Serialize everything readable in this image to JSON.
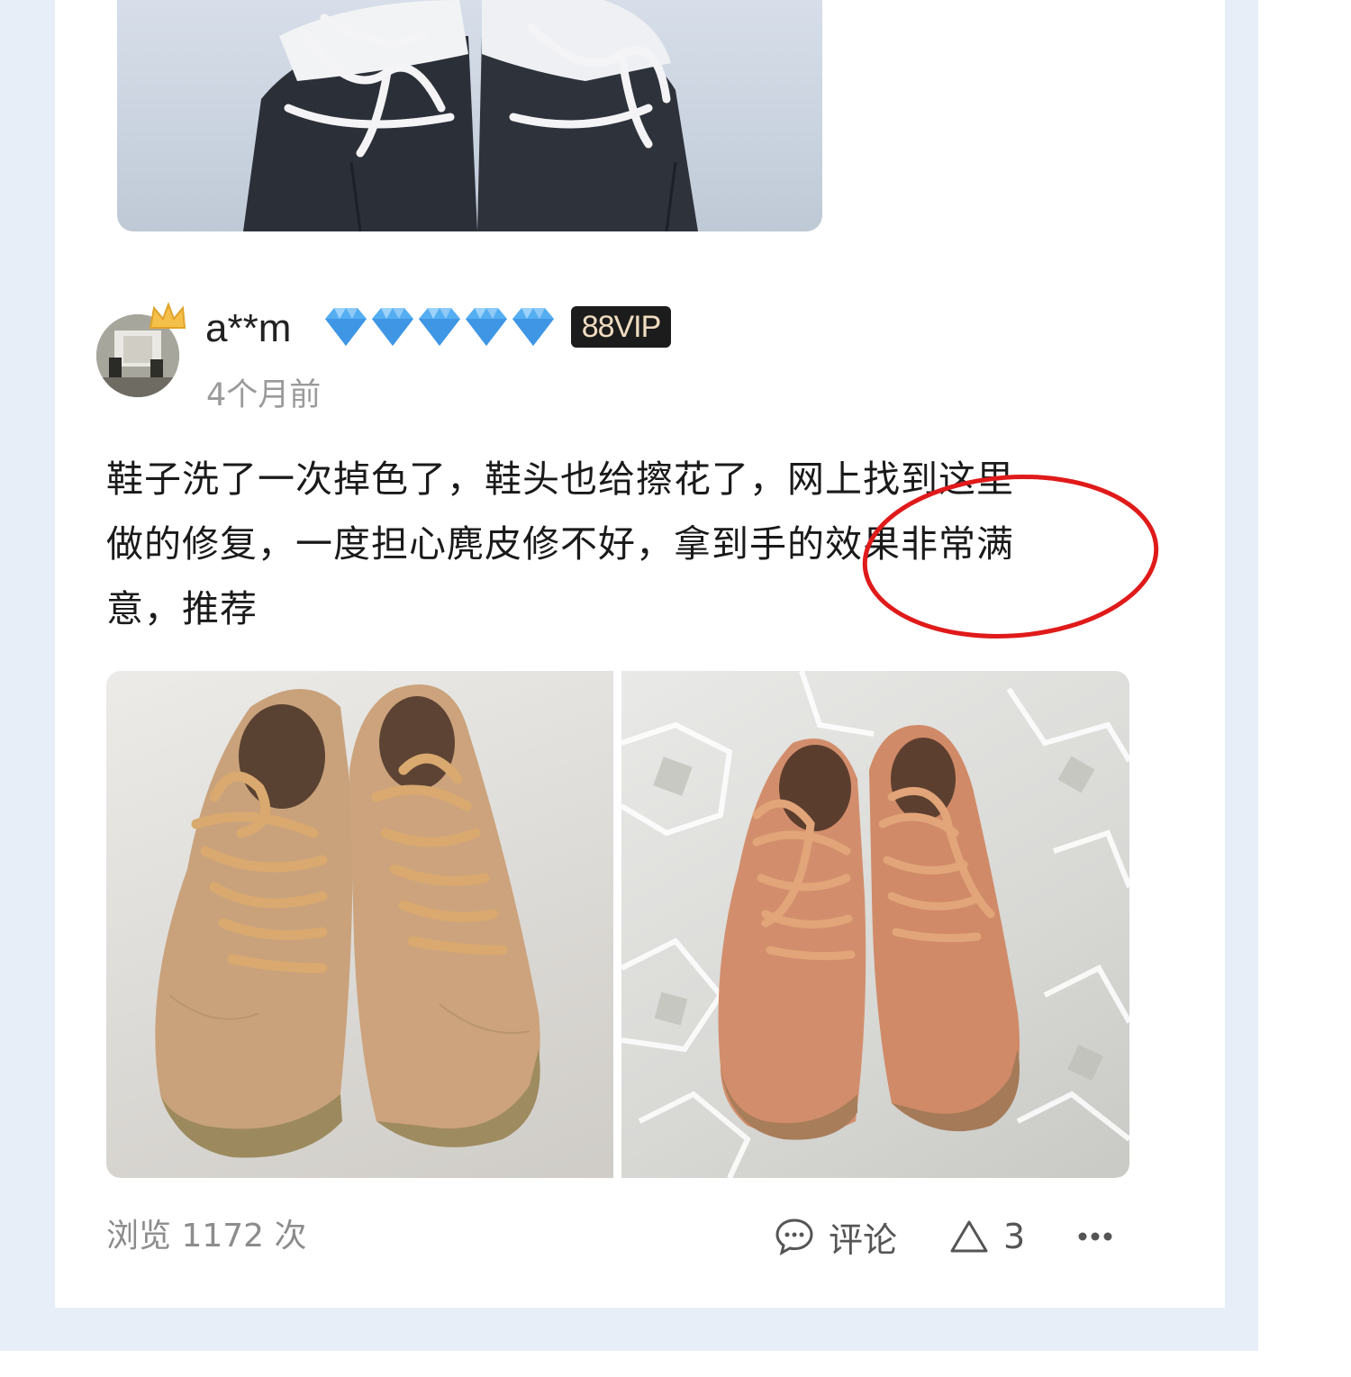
{
  "review": {
    "username": "a**m",
    "level_icons": [
      "diamond-icon",
      "diamond-icon",
      "diamond-icon",
      "diamond-icon",
      "diamond-icon"
    ],
    "badge": "88VIP",
    "timestamp": "4个月前",
    "text_line_1": "鞋子洗了一次掉色了，鞋头也给擦花了，网上找到这里",
    "text_line_2": "做的修复，一度担心麂皮修不好，拿到手的效果非常满",
    "text_line_3": "意，推荐",
    "images": [
      "shoes-before-photo",
      "shoes-after-photo"
    ]
  },
  "footer": {
    "views": "浏览 1172 次",
    "comment_label": "评论",
    "like_count": "3",
    "more_icon": "more-dots-icon"
  },
  "colors": {
    "diamond": "#4fa8ef",
    "badge_bg": "#1c1c1c",
    "badge_text": "#f0dcc0",
    "annotation": "#e01a1a",
    "secondary_text": "#9a9a9a"
  }
}
